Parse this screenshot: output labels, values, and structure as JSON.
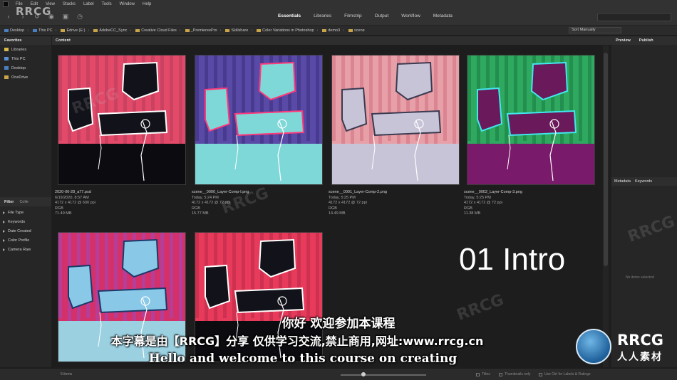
{
  "menu": [
    "File",
    "Edit",
    "View",
    "Stacks",
    "Label",
    "Tools",
    "Window",
    "Help"
  ],
  "workspaces": [
    {
      "label": "Essentials",
      "active": true
    },
    {
      "label": "Libraries",
      "active": false
    },
    {
      "label": "Filmstrip",
      "active": false
    },
    {
      "label": "Output",
      "active": false
    },
    {
      "label": "Workflow",
      "active": false
    },
    {
      "label": "Metadata",
      "active": false
    }
  ],
  "breadcrumbs": [
    "Desktop",
    "This PC",
    "Edrive (E:)",
    "AdobeCC_Sync",
    "Creative Cloud Files",
    "_PremiereePro",
    "Skillshare",
    "Color Variations in Photoshop",
    "demo3",
    "scene"
  ],
  "sort": {
    "label": "Sort Manually"
  },
  "favorites": {
    "tab": "Favorites",
    "items": [
      {
        "label": "Libraries",
        "icon": "libraries-icon",
        "color": "#d8b84a"
      },
      {
        "label": "This PC",
        "icon": "computer-icon",
        "color": "#5a8fd0"
      },
      {
        "label": "Desktop",
        "icon": "desktop-icon",
        "color": "#4a7fc0"
      },
      {
        "label": "OneDrive",
        "icon": "folder-icon",
        "color": "#c9a44a"
      }
    ]
  },
  "filter": {
    "tab": "Filter",
    "tab2": "Colle",
    "items": [
      "File Type",
      "Keywords",
      "Date Created",
      "Color Profile",
      "Camera Raw"
    ]
  },
  "content": {
    "tab": "Content",
    "thumbnails": [
      {
        "name": "2020-06-28_a77.psd",
        "date": "6/19/2020, 8:57 AM",
        "dims": "4172 x 4172 @ 600 ppi",
        "mode": "RGB",
        "size": "71.49 MB",
        "bg": "#e34a6a",
        "floor": "#0c0c10",
        "block": "#12121a",
        "block_edge": "#ffffff",
        "accent": "#b83a58"
      },
      {
        "name": "scene__0000_Layer-Comp-I.png",
        "date": "Today, 5:24 PM",
        "dims": "4172 x 4172 @ 72 ppi",
        "mode": "RGB",
        "size": "15.77 MB",
        "bg": "#5a4aa8",
        "floor": "#7fd8d8",
        "block": "#7fd8d8",
        "block_edge": "#ff3a7a",
        "accent": "#3b2f7a"
      },
      {
        "name": "scene__0001_Layer-Comp-2.png",
        "date": "Today, 5:25 PM",
        "dims": "4172 x 4172 @ 72 ppi",
        "mode": "RGB",
        "size": "14.49 MB",
        "bg": "#e8a0a8",
        "floor": "#c8c4d8",
        "block": "#c8c4d8",
        "block_edge": "#3a3a50",
        "accent": "#d07080"
      },
      {
        "name": "scene__0002_Layer-Comp-3.png",
        "date": "Today, 5:25 PM",
        "dims": "4172 x 4172 @ 72 ppi",
        "mode": "RGB",
        "size": "11.38 MB",
        "bg": "#2fa860",
        "floor": "#7a1a6a",
        "block": "#6a1a5a",
        "block_edge": "#40e8f0",
        "accent": "#1a7a40"
      },
      {
        "name": "",
        "date": "",
        "dims": "",
        "mode": "",
        "size": "",
        "bg": "#d4306a",
        "floor": "#9ad0e0",
        "block": "#8ac8e8",
        "block_edge": "#1a3a6a",
        "accent": "#9a4ac0"
      },
      {
        "name": "",
        "date": "",
        "dims": "",
        "mode": "",
        "size": "",
        "bg": "#e83a5a",
        "floor": "#0c0c10",
        "block": "#12121a",
        "block_edge": "#ffffff",
        "accent": "#b82a48"
      }
    ]
  },
  "right_panel": {
    "tabs": [
      "Preview",
      "Publish"
    ],
    "tabs2": [
      "Metadata",
      "Keywords"
    ],
    "empty_text": "No items selected"
  },
  "status": {
    "count": "6 items",
    "options": [
      "Titles",
      "Thumbnails only",
      "Use Ctrl for Labels & Ratings"
    ],
    "zoom": 0.25
  },
  "overlay": {
    "title": "01 Intro",
    "watermark": "RRCG",
    "subtitle_zh": "你好 欢迎参加本课程",
    "subtitle_notice": "本字幕是由【RRCG】分享 仅供学习交流,禁止商用,网址:www.rrcg.cn",
    "subtitle_en": "Hello and welcome to this course on creating",
    "logo_text": "RRCG",
    "logo_sub": "人人素材"
  }
}
